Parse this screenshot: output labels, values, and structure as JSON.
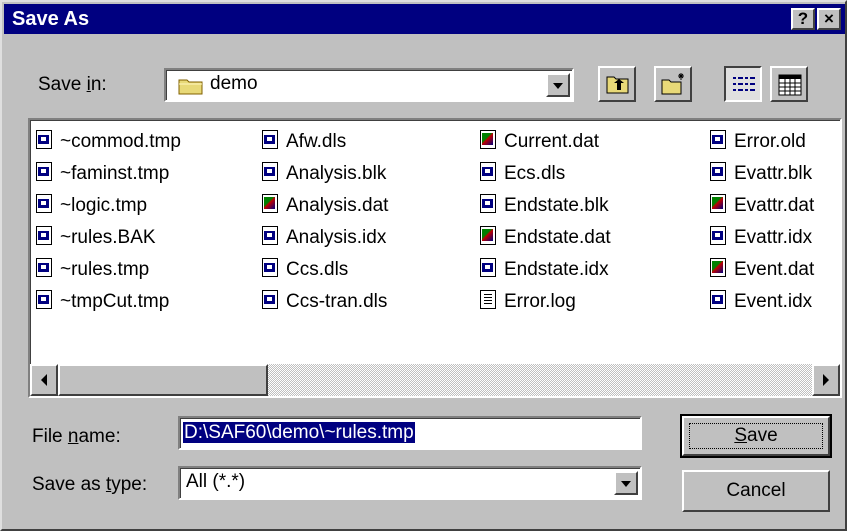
{
  "dialog": {
    "title": "Save As",
    "help_label": "?",
    "close_label": "×"
  },
  "save_in": {
    "label_before": "Save ",
    "label_underlined": "i",
    "label_after": "n:",
    "value": "demo"
  },
  "files": [
    {
      "name": "~commod.tmp",
      "icon": "generic-file-icon"
    },
    {
      "name": "~faminst.tmp",
      "icon": "generic-file-icon"
    },
    {
      "name": "~logic.tmp",
      "icon": "generic-file-icon"
    },
    {
      "name": "~rules.BAK",
      "icon": "generic-file-icon"
    },
    {
      "name": "~rules.tmp",
      "icon": "generic-file-icon"
    },
    {
      "name": "~tmpCut.tmp",
      "icon": "generic-file-icon"
    },
    {
      "name": "Afw.dls",
      "icon": "generic-file-icon"
    },
    {
      "name": "Analysis.blk",
      "icon": "generic-file-icon"
    },
    {
      "name": "Analysis.dat",
      "icon": "data-file-icon"
    },
    {
      "name": "Analysis.idx",
      "icon": "generic-file-icon"
    },
    {
      "name": "Ccs.dls",
      "icon": "generic-file-icon"
    },
    {
      "name": "Ccs-tran.dls",
      "icon": "generic-file-icon"
    },
    {
      "name": "Current.dat",
      "icon": "data-file-icon"
    },
    {
      "name": "Ecs.dls",
      "icon": "generic-file-icon"
    },
    {
      "name": "Endstate.blk",
      "icon": "generic-file-icon"
    },
    {
      "name": "Endstate.dat",
      "icon": "data-file-icon"
    },
    {
      "name": "Endstate.idx",
      "icon": "generic-file-icon"
    },
    {
      "name": "Error.log",
      "icon": "text-file-icon"
    },
    {
      "name": "Error.old",
      "icon": "generic-file-icon"
    },
    {
      "name": "Evattr.blk",
      "icon": "generic-file-icon"
    },
    {
      "name": "Evattr.dat",
      "icon": "data-file-icon"
    },
    {
      "name": "Evattr.idx",
      "icon": "generic-file-icon"
    },
    {
      "name": "Event.dat",
      "icon": "data-file-icon"
    },
    {
      "name": "Event.idx",
      "icon": "generic-file-icon"
    }
  ],
  "file_name": {
    "label_before": "File ",
    "label_underlined": "n",
    "label_after": "ame:",
    "value": "D:\\SAF60\\demo\\~rules.tmp"
  },
  "save_as_type": {
    "label_before": "Save as ",
    "label_underlined": "t",
    "label_after": "ype:",
    "value": "All (*.*)"
  },
  "buttons": {
    "save_underlined": "S",
    "save_rest": "ave",
    "cancel": "Cancel"
  },
  "colors": {
    "titlebar": "#000080",
    "dialog_face": "#c0c0c0",
    "selection": "#000080"
  }
}
